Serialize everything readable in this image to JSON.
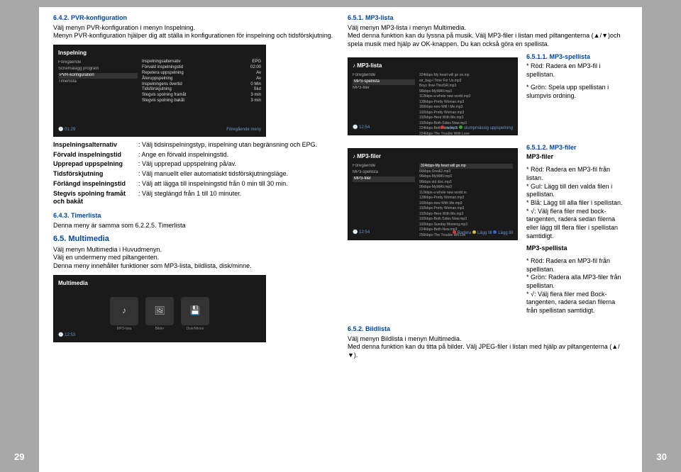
{
  "left": {
    "h1": "6.4.2. PVR-konfiguration",
    "p1": "Välj menyn PVR-konfiguration i menyn Inspelning.",
    "p2": "Menyn PVR-konfiguration hjälper dig att ställa in konfigurationen för inspelning och tidsförskjutning.",
    "screenshot1": {
      "title": "Inspelning",
      "leftItems": [
        "Föregående",
        "Schemalägg program",
        "PVR-konfiguration",
        "Timerlista"
      ],
      "rightRows": [
        [
          "Inspelningsalternativ",
          "EPG"
        ],
        [
          "Förvald inspelningstid",
          "02:00"
        ],
        [
          "Repetera uppspelning",
          "Av"
        ],
        [
          "Återuppspelning",
          "Av"
        ],
        [
          "Inspelningens övertid",
          "0 Min"
        ],
        [
          "Tidsförskjutning",
          "Slut"
        ],
        [
          "Stegvis spolning framåt",
          "3 min"
        ],
        [
          "Stegvis spolning bakåt",
          "3 min"
        ]
      ],
      "footerLeft": "01:29",
      "footerRight": "Föregående meny"
    },
    "defs": {
      "labels": [
        "Inspelningsalternativ",
        "Förvald inspelningstid",
        "Upprepad uppspelning",
        "Tidsförskjutning",
        "Förlängd inspelningstid",
        "Stegvis spolning framåt och bakåt"
      ],
      "values": [
        "Välj tidsinspelningstyp, inspelning utan begränsning och EPG.",
        "Ange en förvald inspelningstid.",
        "Välj upprepad uppspelning på/av.",
        "Välj manuellt eller automatiskt tidsförskjutningsläge.",
        "Välj att lägga till inspelningstid från 0 min till 30 min.",
        "Välj steglängd från 1 till 10 minuter."
      ]
    },
    "h2": "6.4.3. Timerlista",
    "p3": "Denna meny är samma som 6.2.2.5. Timerlista",
    "h3": "6.5. Multimedia",
    "p4": "Välj menyn Multimedia i Huvudmenyn.",
    "p5": "Välj en undermeny med piltangenten.",
    "p6": "Denna meny innehåller funktioner som MP3-lista, bildlista, disk/minne.",
    "screenshot2": {
      "title": "Multimedia",
      "icons": [
        "MP3-lista",
        "Bilder",
        "Disk/Minne"
      ],
      "footerLeft": "12:53"
    }
  },
  "right": {
    "h1": "6.5.1. MP3-lista",
    "p1": "Välj menyn MP3-lista i menyn Multimedia.",
    "p2": "Med denna funktion kan du lyssna på musik. Välj MP3-filer i listan med piltangenterna (▲/▼)och spela musik med hjälp av OK-knappen. Du kan också göra en spellista.",
    "h2": "6.5.1.1. MP3-spellista",
    "b1": "* Röd: Radera en MP3-fil i spellistan.",
    "b2": "* Grön: Spela upp spellistan i slumpvis ordning.",
    "screenshot3": {
      "title": "MP3-lista",
      "leftItems": [
        "Föregående",
        "MP3-spellista",
        "MP3-filer"
      ],
      "rightItems": [
        "324kbps-My heart will go on.mp",
        "air_bag-I Time For Us.mp3",
        "Boyz IInw-ThisISR.mp3",
        "96kbps-MyWAV.mp3",
        "112kbps-a whole new world.mp3",
        "128kbps-Pretty Woman.mp3",
        "160kbps-new Will / Me.mp3",
        "192kbps-Pretty Woman.mp3",
        "192kbps-Here With Me.mp3",
        "192kbps-Both Sides Now.mp3",
        "224kbps-Beth-New.mp3",
        "224kbps-The Trouble With Love"
      ],
      "footerLeft": "12:54",
      "footerRed": "radera",
      "footerGreen": "slumpmässig uppspelning"
    },
    "h3": "6.5.1.2. MP3-filer",
    "h3b": "MP3-filer",
    "b3": "* Röd: Radera en MP3-fil från listan.",
    "b4": "* Gul: Lägg till den valda filen i spellistan.",
    "b5": "* Blå: Lägg till alla filer i spellistan.",
    "b6": "* √: Välj flera filer med bock-tangenten, radera sedan     filerna eller lägg till flera filer i spellistan samtidigt.",
    "h3c": "MP3-spellista",
    "b7": "* Röd: Radera en MP3-fil från spellistan.",
    "b8": "* Grön: Radera alla MP3-filer från spellistan.",
    "b9": "* √: Välj flera filer med Bock-tangenten, radera sedan filerna från spellistan samtidigt.",
    "screenshot4": {
      "title": "MP3-filer",
      "leftItems": [
        "Föregående",
        "MP3-spellista",
        "MP3-filer"
      ],
      "rightItems": [
        "324kbps-My heart will go.mp",
        "66kbps.One&2.mp3",
        "96kbps-MyWAV.mp3",
        "96kbps old disc.mp3",
        "96kbps-MyWAV.mp3",
        "112kbps-a whole new world.m",
        "128kbps-Pretty Woman.mp3",
        "160kbps-new With Me.mp3",
        "192kbps-Pretty Woman.mp3",
        "192kbps-Here With Me.mp3",
        "192kbps-Both Sides Now.mp3",
        "192kbps-Sunday Morning.mp3",
        "224kbps-Beth-New.mp3",
        "256kbps-The Trouble Wit Lov"
      ],
      "footerLeft": "12:54",
      "footerRed": "Radera",
      "footerYellow": "Lägg till",
      "footerBlue": "Lägg till"
    },
    "h4": "6.5.2. Bildlista",
    "p7": "Välj menyn Bildlista i menyn Multimedia.",
    "p8": "Med denna funktion kan du titta på bilder. Välj JPEG-filer i listan med hjälp av piltangenterna (▲/▼)."
  },
  "pageLeft": "29",
  "pageRight": "30"
}
